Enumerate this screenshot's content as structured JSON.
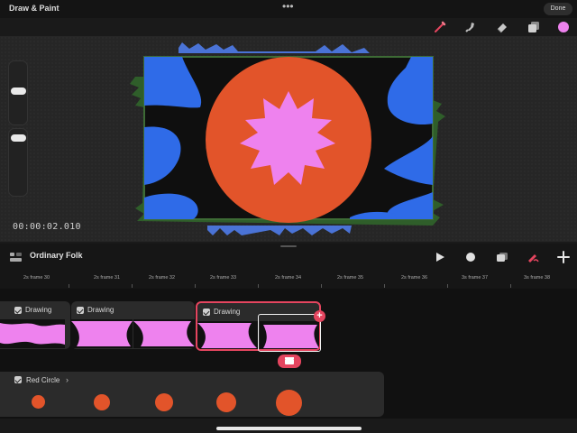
{
  "app": {
    "title": "Draw & Paint",
    "more_icon": "ellipsis-icon",
    "done_label": "Done"
  },
  "tools": [
    {
      "name": "brush-tool",
      "icon": "brush-icon",
      "active": true
    },
    {
      "name": "smudge-tool",
      "icon": "smudge-icon",
      "active": false
    },
    {
      "name": "eraser-tool",
      "icon": "eraser-icon",
      "active": false
    },
    {
      "name": "layers-tool",
      "icon": "layers-icon",
      "active": false
    },
    {
      "name": "color-tool",
      "icon": "color-swatch-icon",
      "color": "#ee82ee"
    }
  ],
  "colors": {
    "accent": "#e5455f",
    "pink": "#ee82ee",
    "orange": "#e2542a",
    "blue": "#2f6be8",
    "green": "#3a7a2e"
  },
  "canvas": {
    "timecode": "00:00:02.010"
  },
  "timeline": {
    "project_name": "Ordinary Folk",
    "controls": [
      "play-icon",
      "record-icon",
      "onion-skin-icon",
      "draw-mode-icon",
      "add-icon"
    ],
    "frames": [
      "2s frame 30",
      "2s frame 31",
      "2s frame 32",
      "2s frame 33",
      "2s frame 34",
      "2s frame 35",
      "2s frame 36",
      "3s frame 37",
      "3s frame 38"
    ],
    "clips": [
      {
        "label": "Drawing"
      },
      {
        "label": "Drawing"
      },
      {
        "label": "Drawing"
      }
    ],
    "group": {
      "label": "Red Circle",
      "chevron": "›",
      "keyframes": 5
    }
  }
}
